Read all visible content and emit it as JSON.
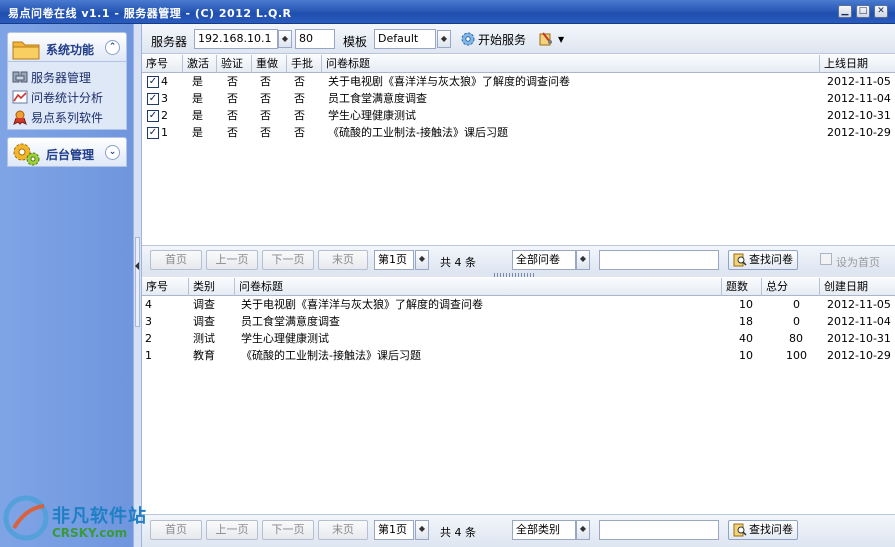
{
  "window": {
    "title": "易点问卷在线 v1.1 - 服务器管理 - (C) 2012 L.Q.R",
    "controls": [
      "▁",
      "□",
      "✕"
    ]
  },
  "sidebar": {
    "panels": [
      {
        "label": "系统功能",
        "toggle": "⌃",
        "items": [
          {
            "label": "服务器管理",
            "icon": "server-icon"
          },
          {
            "label": "问卷统计分析",
            "icon": "chart-icon"
          },
          {
            "label": "易点系列软件",
            "icon": "software-icon"
          }
        ]
      },
      {
        "label": "后台管理",
        "toggle": "⌄",
        "items": []
      }
    ]
  },
  "toolbar": {
    "server_label": "服务器",
    "server_value": "192.168.10.1",
    "port_value": "80",
    "template_label": "模板",
    "template_value": "Default",
    "start_label": "开始服务"
  },
  "top_grid": {
    "headers": [
      "序号",
      "激活",
      "验证",
      "重做",
      "手批",
      "问卷标题",
      "上线日期"
    ],
    "rows": [
      {
        "no": "4",
        "active": "是",
        "verify": "否",
        "redo": "否",
        "manual": "否",
        "title": "关于电视剧《喜洋洋与灰太狼》了解度的调查问卷",
        "date": "2012-11-05"
      },
      {
        "no": "3",
        "active": "是",
        "verify": "否",
        "redo": "否",
        "manual": "否",
        "title": "员工食堂满意度调查",
        "date": "2012-11-04"
      },
      {
        "no": "2",
        "active": "是",
        "verify": "否",
        "redo": "否",
        "manual": "否",
        "title": "学生心理健康测试",
        "date": "2012-10-31"
      },
      {
        "no": "1",
        "active": "是",
        "verify": "否",
        "redo": "否",
        "manual": "否",
        "title": "《硫酸的工业制法-接触法》课后习题",
        "date": "2012-10-29"
      }
    ]
  },
  "top_pager": {
    "first": "首页",
    "prev": "上一页",
    "next": "下一页",
    "last": "末页",
    "page": "第1页",
    "total": "共 4 条",
    "filter": "全部问卷",
    "find": "查找问卷",
    "set_home": "设为首页"
  },
  "bottom_grid": {
    "headers": [
      "序号",
      "类别",
      "问卷标题",
      "题数",
      "总分",
      "创建日期"
    ],
    "rows": [
      {
        "no": "4",
        "category": "调查",
        "title": "关于电视剧《喜洋洋与灰太狼》了解度的调查问卷",
        "count": "10",
        "score": "0",
        "date": "2012-11-05"
      },
      {
        "no": "3",
        "category": "调查",
        "title": "员工食堂满意度调查",
        "count": "18",
        "score": "0",
        "date": "2012-11-04"
      },
      {
        "no": "2",
        "category": "测试",
        "title": "学生心理健康测试",
        "count": "40",
        "score": "80",
        "date": "2012-10-31"
      },
      {
        "no": "1",
        "category": "教育",
        "title": "《硫酸的工业制法-接触法》课后习题",
        "count": "10",
        "score": "100",
        "date": "2012-10-29"
      }
    ]
  },
  "bottom_pager": {
    "first": "首页",
    "prev": "上一页",
    "next": "下一页",
    "last": "末页",
    "page": "第1页",
    "total": "共 4 条",
    "filter": "全部类别",
    "find": "查找问卷"
  },
  "watermark": {
    "line1": "非凡软件站",
    "line2": "CRSKY.com"
  },
  "colors": {
    "titlebar": "#1f4fae",
    "sidebar": "#7fa4e6",
    "accent": "#1f3d8a"
  }
}
